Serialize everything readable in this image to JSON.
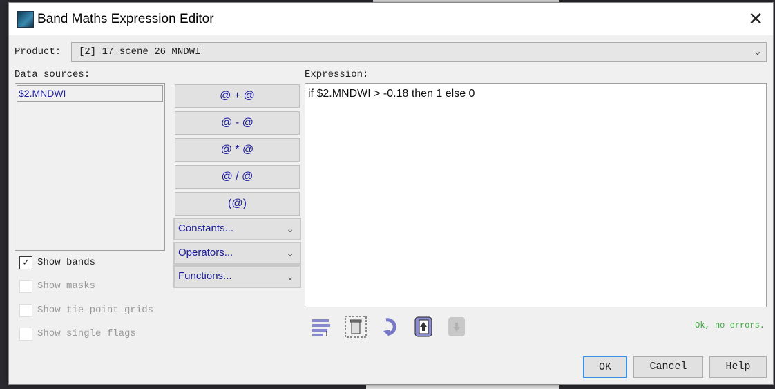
{
  "window": {
    "title": "Band Maths Expression Editor",
    "close_label": "✕"
  },
  "product": {
    "label": "Product:",
    "value": "[2] 17_scene_26_MNDWI"
  },
  "data_sources": {
    "label": "Data sources:",
    "items": [
      "$2.MNDWI"
    ]
  },
  "operator_buttons": [
    "@ + @",
    "@ - @",
    "@ * @",
    "@ / @",
    "(@)"
  ],
  "dropdowns": [
    "Constants...",
    "Operators...",
    "Functions..."
  ],
  "checkboxes": [
    {
      "label": "Show bands",
      "checked": true,
      "enabled": true
    },
    {
      "label": "Show masks",
      "checked": false,
      "enabled": false
    },
    {
      "label": "Show tie-point grids",
      "checked": false,
      "enabled": false
    },
    {
      "label": "Show single flags",
      "checked": false,
      "enabled": false
    }
  ],
  "expression": {
    "label": "Expression:",
    "value": "if $2.MNDWI > -0.18 then 1 else 0"
  },
  "status": "Ok, no errors.",
  "buttons": {
    "ok": "OK",
    "cancel": "Cancel",
    "help": "Help"
  },
  "colors": {
    "accent": "#1c1c9c",
    "status": "#3aaa3a"
  }
}
